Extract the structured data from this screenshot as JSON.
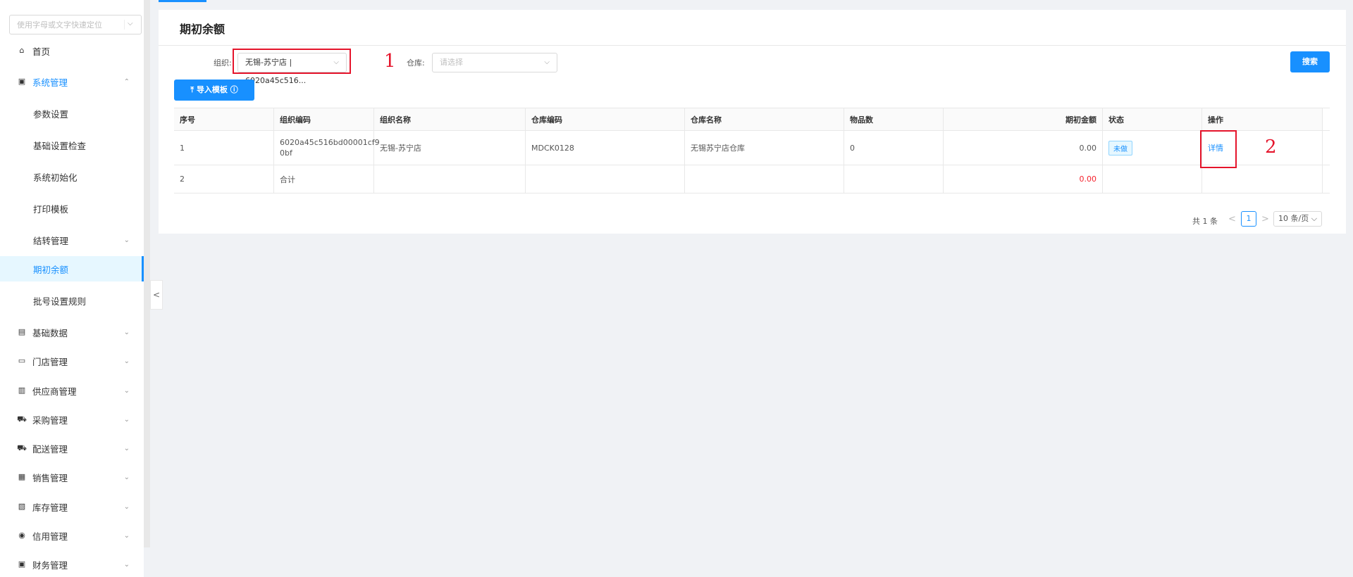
{
  "sidebar": {
    "search_placeholder": "使用字母或文字快速定位",
    "items": [
      {
        "label": "首页",
        "icon": "home-icon",
        "glyph": "⌂"
      },
      {
        "label": "系统管理",
        "icon": "system-icon",
        "glyph": "▣",
        "arrow": "⌃"
      },
      {
        "label": "参数设置"
      },
      {
        "label": "基础设置检查"
      },
      {
        "label": "系统初始化"
      },
      {
        "label": "打印模板"
      },
      {
        "label": "结转管理",
        "arrow": "⌄"
      },
      {
        "label": "期初余额"
      },
      {
        "label": "批号设置规则"
      },
      {
        "label": "基础数据",
        "icon": "basic-data-icon",
        "glyph": "▤",
        "arrow": "⌄"
      },
      {
        "label": "门店管理",
        "icon": "store-icon",
        "glyph": "▭",
        "arrow": "⌄"
      },
      {
        "label": "供应商管理",
        "icon": "supplier-icon",
        "glyph": "▥",
        "arrow": "⌄"
      },
      {
        "label": "采购管理",
        "icon": "cart-icon",
        "glyph": "⛟",
        "arrow": "⌄"
      },
      {
        "label": "配送管理",
        "icon": "delivery-icon",
        "glyph": "⛟",
        "arrow": "⌄"
      },
      {
        "label": "销售管理",
        "icon": "sales-icon",
        "glyph": "▦",
        "arrow": "⌄"
      },
      {
        "label": "库存管理",
        "icon": "inventory-icon",
        "glyph": "▧",
        "arrow": "⌄"
      },
      {
        "label": "信用管理",
        "icon": "credit-icon",
        "glyph": "◉",
        "arrow": "⌄"
      },
      {
        "label": "财务管理",
        "icon": "finance-icon",
        "glyph": "▣",
        "arrow": "⌄"
      }
    ],
    "collapse_glyph": "<"
  },
  "page": {
    "title": "期初余额"
  },
  "filters": {
    "org_label": "组织:",
    "org_value": "无锡-苏宁店 | 6020a45c516...",
    "warehouse_label": "仓库:",
    "warehouse_placeholder": "请选择",
    "search_label": "搜索",
    "import_label": "导入模板"
  },
  "annotations": {
    "one": "1",
    "two": "2"
  },
  "table": {
    "headers": [
      "序号",
      "组织编码",
      "组织名称",
      "仓库编码",
      "仓库名称",
      "物品数",
      "期初金额",
      "状态",
      "操作"
    ],
    "rows": [
      {
        "seq": "1",
        "org_code_line1": "6020a45c516bd00001cf9",
        "org_code_line2": "0bf",
        "org_name": "无锡-苏宁店",
        "wh_code": "MDCK0128",
        "wh_name": "无锡苏宁店仓库",
        "items": "0",
        "amount": "0.00",
        "status": "未做",
        "action": "详情"
      },
      {
        "seq": "2",
        "org_code": "合计",
        "amount": "0.00"
      }
    ]
  },
  "pagination": {
    "total": "共 1 条",
    "prev": "<",
    "current": "1",
    "next": ">",
    "page_size": "10 条/页"
  }
}
